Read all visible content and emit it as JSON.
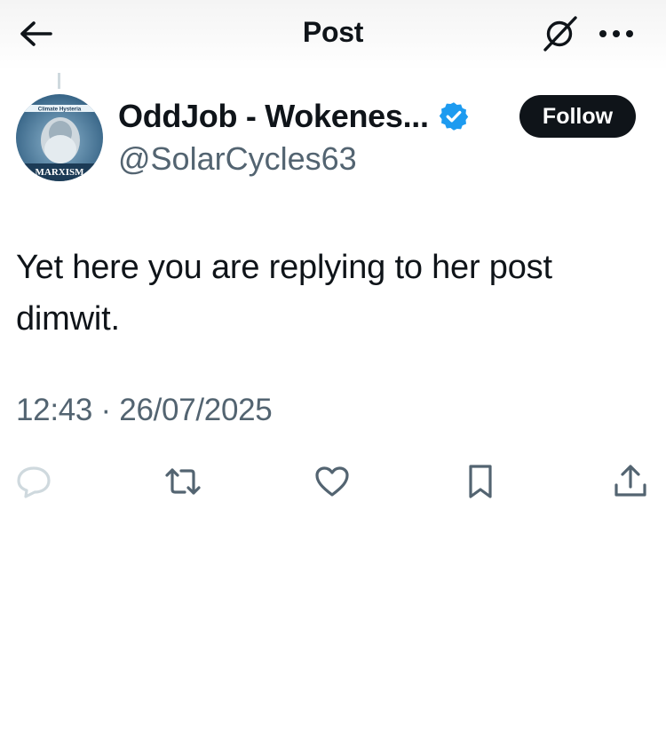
{
  "header": {
    "title": "Post",
    "back_icon": "arrow-left-icon",
    "grok_icon": "grok-icon",
    "more_icon": "more-horizontal-icon"
  },
  "author": {
    "display_name": "OddJob - Wokenes...",
    "handle": "@SolarCycles63",
    "verified": true,
    "verified_color": "#1d9bf0",
    "avatar": {
      "banner_text": "Climate Hysteria",
      "bottom_text": "MARXISM"
    }
  },
  "follow_label": "Follow",
  "post": {
    "text": "Yet here you are replying to her post dimwit.",
    "timestamp": "12:43 · 26/07/2025"
  },
  "actions": [
    {
      "name": "reply",
      "icon": "reply-icon"
    },
    {
      "name": "repost",
      "icon": "repost-icon"
    },
    {
      "name": "like",
      "icon": "heart-icon"
    },
    {
      "name": "bookmark",
      "icon": "bookmark-icon"
    },
    {
      "name": "share",
      "icon": "share-icon"
    }
  ],
  "colors": {
    "text": "#0f1419",
    "secondary": "#536471",
    "accent": "#1d9bf0",
    "follow_bg": "#0f1419"
  }
}
